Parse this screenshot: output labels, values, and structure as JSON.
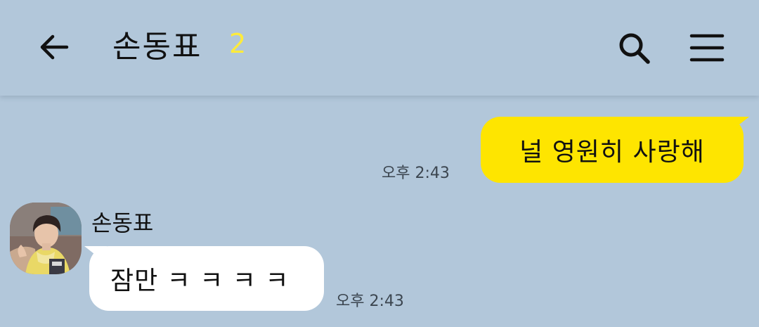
{
  "header": {
    "title": "손동표",
    "member_count": "2",
    "back_icon": "arrow-left-icon",
    "search_icon": "search-icon",
    "menu_icon": "hamburger-menu-icon"
  },
  "messages": [
    {
      "direction": "outgoing",
      "text": "널 영원히 사랑해",
      "time": "오후 2:43",
      "bubble_color": "#fee500"
    },
    {
      "direction": "incoming",
      "sender": "손동표",
      "text": "잠만 ㅋ ㅋ ㅋ ㅋ",
      "time": "오후 2:43",
      "bubble_color": "#ffffff"
    }
  ],
  "colors": {
    "background": "#b2c7da",
    "count_badge": "#ffeb3b"
  }
}
